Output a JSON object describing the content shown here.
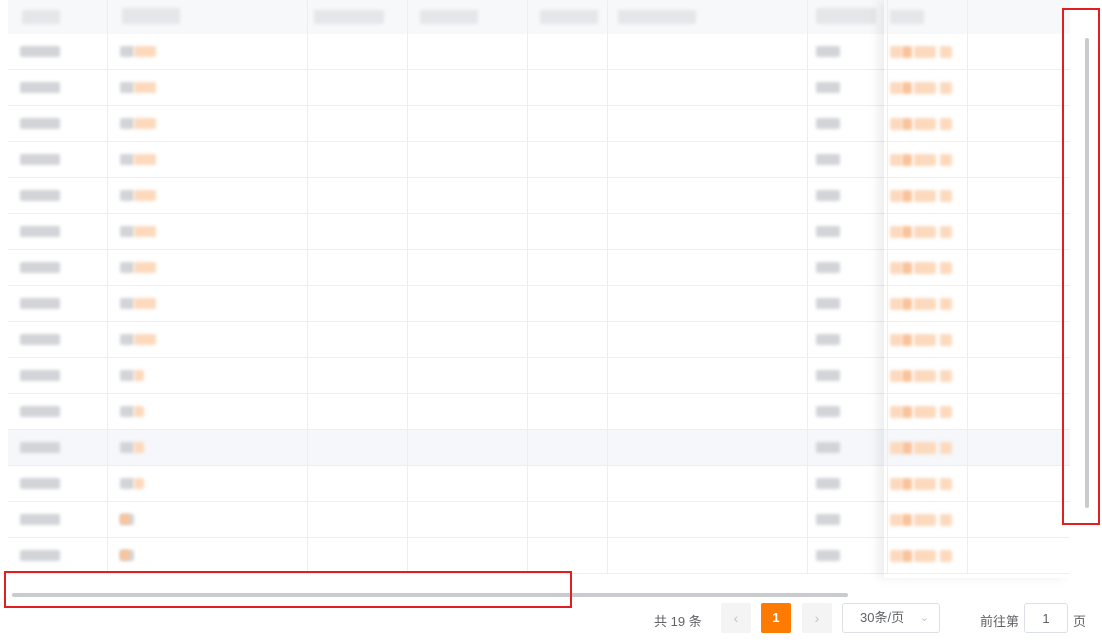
{
  "table": {
    "row_count": 15,
    "hovered_row_index": 11
  },
  "pagination": {
    "total_text": "共 19 条",
    "prev_icon": "‹",
    "current_page": "1",
    "next_icon": "›",
    "page_size": "30条/页",
    "page_size_chevron": "⌄",
    "goto_label": "前往第",
    "goto_value": "1",
    "goto_suffix": "页"
  },
  "colors": {
    "accent_orange": "#ff7a00",
    "highlight_red": "#e02020",
    "link_blue": "#409eff"
  }
}
